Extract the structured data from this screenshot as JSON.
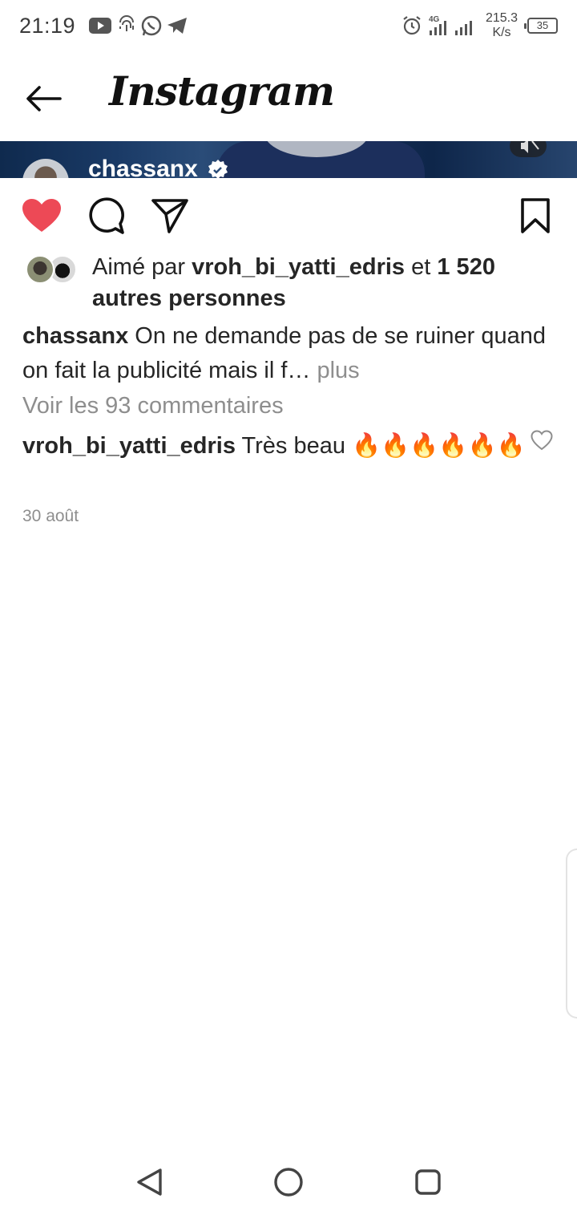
{
  "status_bar": {
    "time": "21:19",
    "network_speed_value": "215.3",
    "network_speed_unit": "K/s",
    "network_type": "4G",
    "battery": "35",
    "icons": [
      "youtube-icon",
      "fingerprint-icon",
      "whatsapp-icon",
      "telegram-icon",
      "alarm-icon",
      "signal-icon"
    ]
  },
  "header": {
    "brand": "Instagram"
  },
  "post": {
    "owner_username": "chassanx",
    "likes": {
      "prefix": "Aimé par ",
      "user": "vroh_bi_yatti_edris",
      "connector": " et ",
      "others": "1 520 autres personnes"
    },
    "caption": {
      "username": "chassanx",
      "text": " On ne demande pas de se ruiner quand on fait la publicité mais il f… ",
      "more": "plus"
    },
    "view_comments": "Voir les 93 commentaires",
    "comment": {
      "username": "vroh_bi_yatti_edris",
      "text": " Très beau 🔥🔥🔥🔥🔥🔥"
    },
    "date": "30 août"
  },
  "colors": {
    "like_red": "#ed4956",
    "text_primary": "#262626",
    "text_secondary": "#8e8e8e",
    "verified_blue": "#ffffff"
  }
}
